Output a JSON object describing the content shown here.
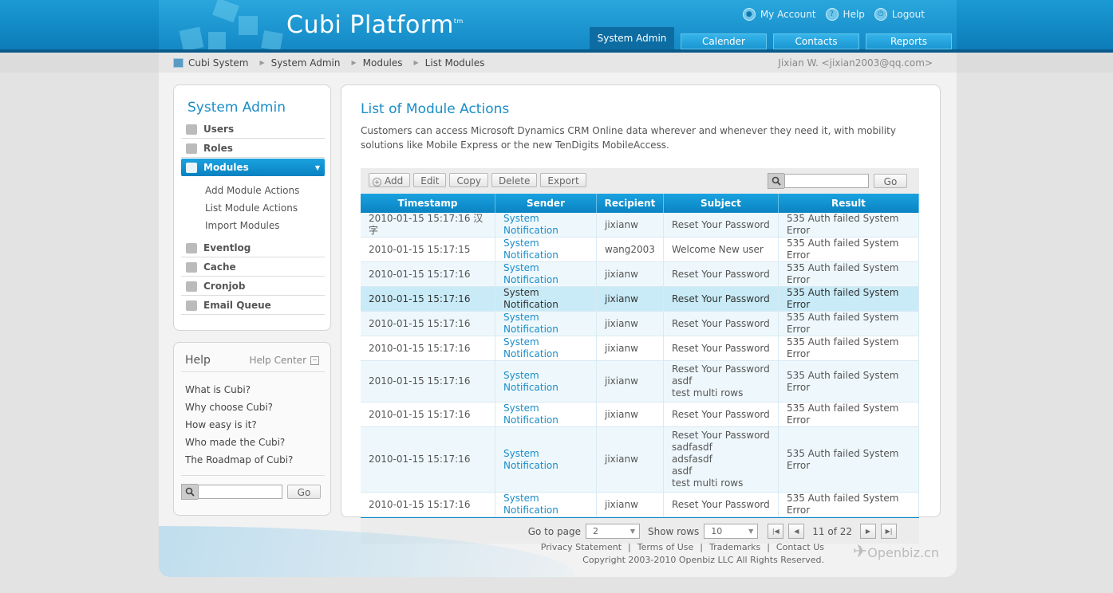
{
  "app": {
    "title": "Cubi Platform",
    "tm": "tm"
  },
  "toplinks": {
    "my_account": "My Account",
    "help": "Help",
    "logout": "Logout"
  },
  "nav": {
    "active": "System Admin",
    "tabs": [
      "Calender",
      "Contacts",
      "Reports"
    ]
  },
  "breadcrumb": {
    "items": [
      "Cubi System",
      "System Admin",
      "Modules",
      "List Modules"
    ],
    "user": "Jixian W. <jixian2003@qq.com>"
  },
  "sidebar": {
    "title": "System Admin",
    "items": [
      "Users",
      "Roles",
      "Modules"
    ],
    "subitems": [
      "Add Module Actions",
      "List Module Actions",
      "Import Modules"
    ],
    "items2": [
      "Eventlog",
      "Cache",
      "Cronjob",
      "Email Queue"
    ]
  },
  "help": {
    "title": "Help",
    "center": "Help Center",
    "links": [
      "What is Cubi?",
      "Why choose Cubi?",
      "How easy is it?",
      "Who made the Cubi?",
      "The Roadmap of Cubi?"
    ],
    "go": "Go"
  },
  "main": {
    "title": "List of Module Actions",
    "description": "Customers can access Microsoft Dynamics CRM Online data wherever and whenever they need it, with mobility solutions like Mobile Express or the new TenDigits MobileAccess.",
    "toolbar": {
      "add": "Add",
      "edit": "Edit",
      "copy": "Copy",
      "delete": "Delete",
      "export": "Export",
      "go": "Go"
    },
    "columns": [
      "Timestamp",
      "Sender",
      "Recipient",
      "Subject",
      "Result"
    ],
    "rows": [
      {
        "timestamp": "2010-01-15 15:17:16 汉字",
        "sender": "System Notification",
        "recipient": "jixianw",
        "subject": [
          "Reset Your Password"
        ],
        "result": "535 Auth failed System Error"
      },
      {
        "timestamp": "2010-01-15 15:17:15",
        "sender": "System Notification",
        "recipient": "wang2003",
        "subject": [
          "Welcome New user"
        ],
        "result": "535 Auth failed System Error"
      },
      {
        "timestamp": "2010-01-15 15:17:16",
        "sender": "System Notification",
        "recipient": "jixianw",
        "subject": [
          "Reset Your Password"
        ],
        "result": "535 Auth failed System Error"
      },
      {
        "timestamp": "2010-01-15 15:17:16",
        "sender": "System Notification",
        "recipient": "jixianw",
        "subject": [
          "Reset Your Password"
        ],
        "result": "535 Auth failed System Error"
      },
      {
        "timestamp": "2010-01-15 15:17:16",
        "sender": "System Notification",
        "recipient": "jixianw",
        "subject": [
          "Reset Your Password"
        ],
        "result": "535 Auth failed System Error"
      },
      {
        "timestamp": "2010-01-15 15:17:16",
        "sender": "System Notification",
        "recipient": "jixianw",
        "subject": [
          "Reset Your Password"
        ],
        "result": "535 Auth failed System Error"
      },
      {
        "timestamp": "2010-01-15 15:17:16",
        "sender": "System Notification",
        "recipient": "jixianw",
        "subject": [
          "Reset Your Password",
          "asdf",
          "test multi rows"
        ],
        "result": "535 Auth failed System Error"
      },
      {
        "timestamp": "2010-01-15 15:17:16",
        "sender": "System Notification",
        "recipient": "jixianw",
        "subject": [
          "Reset Your Password"
        ],
        "result": "535 Auth failed System Error"
      },
      {
        "timestamp": "2010-01-15 15:17:16",
        "sender": "System Notification",
        "recipient": "jixianw",
        "subject": [
          "Reset Your Password",
          "sadfasdf",
          "adsfasdf",
          "asdf",
          "test multi rows"
        ],
        "result": "535 Auth failed System Error"
      },
      {
        "timestamp": "2010-01-15 15:17:16",
        "sender": "System Notification",
        "recipient": "jixianw",
        "subject": [
          "Reset Your Password"
        ],
        "result": "535 Auth failed System Error"
      }
    ],
    "highlight_row": 3,
    "pager": {
      "go_to_page": "Go to page",
      "page": "2",
      "show_rows": "Show rows",
      "rows": "10",
      "status": "11 of 22"
    }
  },
  "footer": {
    "links": [
      "Privacy Statement",
      "Terms of Use",
      "Trademarks",
      "Contact Us"
    ],
    "copyright": "Copyright 2003-2010 Openbiz LLC All Rights Reserved.",
    "brand": "Openbiz.cn"
  },
  "colors": {
    "accent": "#1a8dc8",
    "header": "#1389c6",
    "selected_row": "#c9ebf8"
  }
}
